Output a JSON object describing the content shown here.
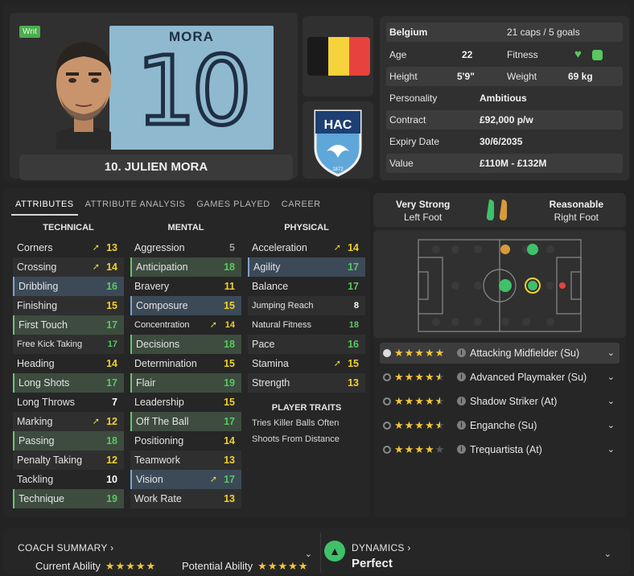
{
  "player": {
    "wnt_badge": "Wnt",
    "shirt_name": "MORA",
    "shirt_number": "10",
    "display_name": "10. JULIEN MORA"
  },
  "info": {
    "nationality": "Belgium",
    "caps": "21 caps / 5 goals",
    "age_label": "Age",
    "age": "22",
    "fitness_label": "Fitness",
    "height_label": "Height",
    "height": "5'9\"",
    "weight_label": "Weight",
    "weight": "69 kg",
    "personality_label": "Personality",
    "personality": "Ambitious",
    "contract_label": "Contract",
    "contract": "£92,000 p/w",
    "expiry_label": "Expiry Date",
    "expiry": "30/6/2035",
    "value_label": "Value",
    "value": "£110M - £132M"
  },
  "club_badge": {
    "letters": "HAC",
    "year": "1872"
  },
  "tabs": [
    "ATTRIBUTES",
    "ATTRIBUTE ANALYSIS",
    "GAMES PLAYED",
    "CAREER"
  ],
  "technical": {
    "title": "TECHNICAL",
    "rows": [
      {
        "name": "Corners",
        "value": "13",
        "arrow": true,
        "hl": "",
        "color": "yellow"
      },
      {
        "name": "Crossing",
        "value": "14",
        "arrow": true,
        "hl": "",
        "color": "yellow"
      },
      {
        "name": "Dribbling",
        "value": "16",
        "arrow": false,
        "hl": "blue",
        "color": "green"
      },
      {
        "name": "Finishing",
        "value": "15",
        "arrow": false,
        "hl": "",
        "color": "yellow"
      },
      {
        "name": "First Touch",
        "value": "17",
        "arrow": false,
        "hl": "green",
        "color": "green"
      },
      {
        "name": "Free Kick Taking",
        "value": "17",
        "arrow": false,
        "hl": "",
        "color": "green",
        "small": true
      },
      {
        "name": "Heading",
        "value": "14",
        "arrow": false,
        "hl": "",
        "color": "yellow"
      },
      {
        "name": "Long Shots",
        "value": "17",
        "arrow": false,
        "hl": "green",
        "color": "green"
      },
      {
        "name": "Long Throws",
        "value": "7",
        "arrow": false,
        "hl": "",
        "color": "white"
      },
      {
        "name": "Marking",
        "value": "12",
        "arrow": true,
        "hl": "",
        "color": "yellow"
      },
      {
        "name": "Passing",
        "value": "18",
        "arrow": false,
        "hl": "green",
        "color": "green"
      },
      {
        "name": "Penalty Taking",
        "value": "12",
        "arrow": false,
        "hl": "",
        "color": "yellow"
      },
      {
        "name": "Tackling",
        "value": "10",
        "arrow": false,
        "hl": "",
        "color": "white"
      },
      {
        "name": "Technique",
        "value": "19",
        "arrow": false,
        "hl": "green",
        "color": "green"
      }
    ]
  },
  "mental": {
    "title": "MENTAL",
    "rows": [
      {
        "name": "Aggression",
        "value": "5",
        "arrow": false,
        "hl": "",
        "color": "grey"
      },
      {
        "name": "Anticipation",
        "value": "18",
        "arrow": false,
        "hl": "green",
        "color": "green"
      },
      {
        "name": "Bravery",
        "value": "11",
        "arrow": false,
        "hl": "",
        "color": "yellow"
      },
      {
        "name": "Composure",
        "value": "15",
        "arrow": false,
        "hl": "blue",
        "color": "yellow"
      },
      {
        "name": "Concentration",
        "value": "14",
        "arrow": true,
        "hl": "",
        "color": "yellow",
        "small": true
      },
      {
        "name": "Decisions",
        "value": "18",
        "arrow": false,
        "hl": "green",
        "color": "green"
      },
      {
        "name": "Determination",
        "value": "15",
        "arrow": false,
        "hl": "",
        "color": "yellow"
      },
      {
        "name": "Flair",
        "value": "19",
        "arrow": false,
        "hl": "green",
        "color": "green"
      },
      {
        "name": "Leadership",
        "value": "15",
        "arrow": false,
        "hl": "",
        "color": "yellow"
      },
      {
        "name": "Off The Ball",
        "value": "17",
        "arrow": false,
        "hl": "green",
        "color": "green"
      },
      {
        "name": "Positioning",
        "value": "14",
        "arrow": false,
        "hl": "",
        "color": "yellow"
      },
      {
        "name": "Teamwork",
        "value": "13",
        "arrow": false,
        "hl": "",
        "color": "yellow"
      },
      {
        "name": "Vision",
        "value": "17",
        "arrow": true,
        "hl": "blue",
        "color": "green"
      },
      {
        "name": "Work Rate",
        "value": "13",
        "arrow": false,
        "hl": "",
        "color": "yellow"
      }
    ]
  },
  "physical": {
    "title": "PHYSICAL",
    "rows": [
      {
        "name": "Acceleration",
        "value": "14",
        "arrow": true,
        "hl": "",
        "color": "yellow"
      },
      {
        "name": "Agility",
        "value": "17",
        "arrow": false,
        "hl": "blue",
        "color": "green"
      },
      {
        "name": "Balance",
        "value": "17",
        "arrow": false,
        "hl": "",
        "color": "green"
      },
      {
        "name": "Jumping Reach",
        "value": "8",
        "arrow": false,
        "hl": "",
        "color": "white",
        "small": true
      },
      {
        "name": "Natural Fitness",
        "value": "18",
        "arrow": false,
        "hl": "",
        "color": "green",
        "small": true
      },
      {
        "name": "Pace",
        "value": "16",
        "arrow": false,
        "hl": "",
        "color": "green"
      },
      {
        "name": "Stamina",
        "value": "15",
        "arrow": true,
        "hl": "",
        "color": "yellow"
      },
      {
        "name": "Strength",
        "value": "13",
        "arrow": false,
        "hl": "",
        "color": "yellow"
      }
    ]
  },
  "traits": {
    "title": "PLAYER TRAITS",
    "items": [
      "Tries Killer Balls Often",
      "Shoots From Distance"
    ]
  },
  "feet": {
    "left_rating": "Very Strong",
    "left_label": "Left Foot",
    "right_rating": "Reasonable",
    "right_label": "Right Foot"
  },
  "roles": [
    {
      "name": "Attacking Midfielder (Su)",
      "stars": 5,
      "selected": true
    },
    {
      "name": "Advanced Playmaker (Su)",
      "stars": 4.5,
      "selected": false
    },
    {
      "name": "Shadow Striker (At)",
      "stars": 4.5,
      "selected": false
    },
    {
      "name": "Enganche (Su)",
      "stars": 4.5,
      "selected": false
    },
    {
      "name": "Trequartista (At)",
      "stars": 4,
      "selected": false
    }
  ],
  "bottom": {
    "coach_title": "COACH SUMMARY",
    "current_label": "Current Ability",
    "potential_label": "Potential Ability",
    "current_stars": "★★★★★",
    "potential_stars": "★★★★★",
    "dynamics_title": "DYNAMICS",
    "dynamics_value": "Perfect"
  },
  "colors": {
    "green": "#57c95f",
    "yellow": "#f2d02b",
    "star": "#f2c53a",
    "flag_black": "#1a1a1a",
    "flag_yellow": "#f6d33c",
    "flag_red": "#e8423f"
  }
}
